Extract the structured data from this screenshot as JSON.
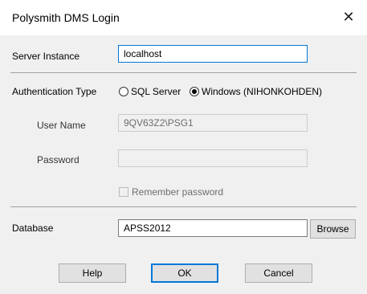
{
  "window": {
    "title": "Polysmith DMS Login",
    "close_label": "✕"
  },
  "form": {
    "server_instance": {
      "label": "Server Instance",
      "value": "localhost"
    },
    "authentication_type": {
      "label": "Authentication Type",
      "options": [
        "SQL Server",
        "Windows (NIHONKOHDEN)"
      ],
      "selected": "Windows (NIHONKOHDEN)"
    },
    "user_name": {
      "label": "User Name",
      "value": "9QV63Z2\\PSG1"
    },
    "password": {
      "label": "Password",
      "value": ""
    },
    "remember_password": {
      "label": "Remember password",
      "checked": false
    },
    "database": {
      "label": "Database",
      "value": "APSS2012",
      "browse_label": "Browse"
    }
  },
  "buttons": {
    "help": "Help",
    "ok": "OK",
    "cancel": "Cancel"
  }
}
